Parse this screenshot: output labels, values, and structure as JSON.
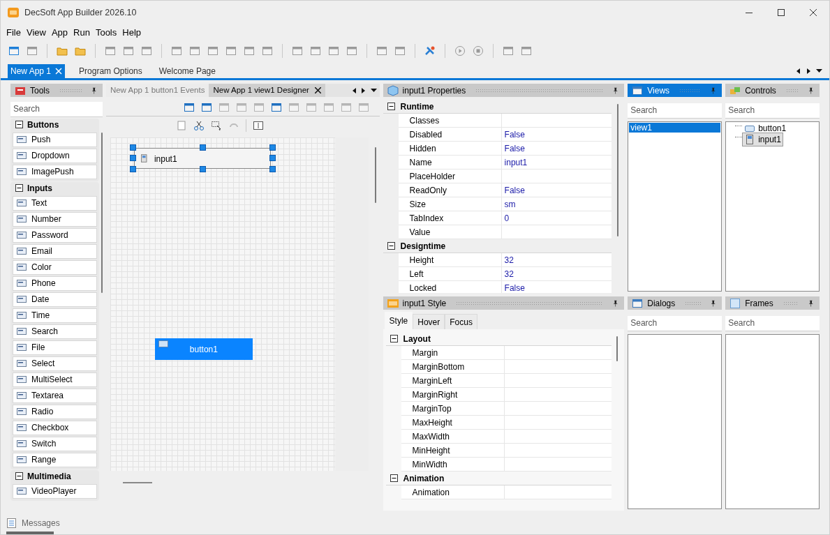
{
  "window": {
    "title": "DecSoft App Builder 2026.10"
  },
  "menu": [
    "File",
    "View",
    "App",
    "Run",
    "Tools",
    "Help"
  ],
  "doc_tabs": [
    {
      "label": "New App 1",
      "selected": true
    },
    {
      "label": "Program Options",
      "selected": false
    },
    {
      "label": "Welcome Page",
      "selected": false
    }
  ],
  "tools": {
    "title": "Tools",
    "active": false,
    "search": {
      "placeholder": "Search"
    },
    "groups": [
      {
        "name": "Buttons",
        "expanded": true,
        "items": [
          "Push",
          "Dropdown",
          "ImagePush"
        ]
      },
      {
        "name": "Inputs",
        "expanded": true,
        "items": [
          "Text",
          "Number",
          "Password",
          "Email",
          "Color",
          "Phone",
          "Date",
          "Time",
          "Search",
          "File",
          "Select",
          "MultiSelect",
          "Textarea",
          "Radio",
          "Checkbox",
          "Switch",
          "Range"
        ]
      },
      {
        "name": "Multimedia",
        "expanded": true,
        "items": [
          "VideoPlayer"
        ]
      }
    ]
  },
  "designer": {
    "tabs": [
      {
        "label": "New App 1 button1 Events",
        "selected": false
      },
      {
        "label": "New App 1 view1 Designer",
        "selected": true
      }
    ],
    "controls": [
      {
        "kind": "input",
        "label": "input1",
        "selected": true
      },
      {
        "kind": "button",
        "label": "button1",
        "selected": false
      }
    ]
  },
  "properties": {
    "title": "input1 Properties",
    "active": false,
    "sections": [
      {
        "name": "Runtime",
        "expanded": true,
        "rows": [
          {
            "name": "Classes"
          },
          {
            "name": "Disabled",
            "value": "False"
          },
          {
            "name": "Hidden",
            "value": "False"
          },
          {
            "name": "Name",
            "value": "input1"
          },
          {
            "name": "PlaceHolder"
          },
          {
            "name": "ReadOnly",
            "value": "False"
          },
          {
            "name": "Size",
            "value": "sm"
          },
          {
            "name": "TabIndex",
            "value": "0"
          },
          {
            "name": "Value"
          }
        ]
      },
      {
        "name": "Designtime",
        "expanded": true,
        "rows": [
          {
            "name": "Height",
            "value": "32"
          },
          {
            "name": "Left",
            "value": "32"
          },
          {
            "name": "Locked",
            "value": "False"
          }
        ]
      }
    ]
  },
  "style": {
    "title": "input1 Style",
    "active": false,
    "tabs": [
      {
        "label": "Style",
        "selected": true
      },
      {
        "label": "Hover",
        "selected": false
      },
      {
        "label": "Focus",
        "selected": false
      }
    ],
    "sections": [
      {
        "name": "Layout",
        "expanded": true,
        "rows": [
          {
            "name": "Margin"
          },
          {
            "name": "MarginBottom"
          },
          {
            "name": "MarginLeft"
          },
          {
            "name": "MarginRight"
          },
          {
            "name": "MarginTop"
          },
          {
            "name": "MaxHeight"
          },
          {
            "name": "MaxWidth"
          },
          {
            "name": "MinHeight"
          },
          {
            "name": "MinWidth"
          }
        ]
      },
      {
        "name": "Animation",
        "expanded": true,
        "rows": [
          {
            "name": "Animation"
          }
        ]
      }
    ]
  },
  "views": {
    "title": "Views",
    "active": true,
    "search": {
      "placeholder": "Search"
    },
    "items": [
      {
        "label": "view1",
        "selected": true
      }
    ]
  },
  "controls": {
    "title": "Controls",
    "active": false,
    "search": {
      "placeholder": "Search"
    },
    "items": [
      {
        "label": "button1",
        "kind": "button",
        "selected": false
      },
      {
        "label": "input1",
        "kind": "input",
        "selected": true
      }
    ]
  },
  "dialogs": {
    "title": "Dialogs",
    "active": false,
    "search": {
      "placeholder": "Search"
    }
  },
  "frames": {
    "title": "Frames",
    "active": false,
    "search": {
      "placeholder": "Search"
    }
  },
  "status_bar": {
    "label": "Messages"
  }
}
